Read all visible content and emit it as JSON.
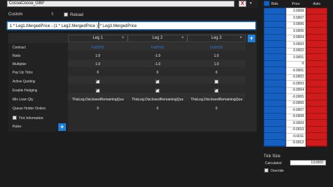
{
  "topbar": {
    "symbol": "CocoaCocoa_GBP",
    "close": "X"
  },
  "toolbar": {
    "mode": "Custom",
    "reload": "Reload"
  },
  "formula": {
    "left": "1 * Leg1.MergedPrice - (1 * Leg2.MergedPrice )",
    "right": "* Leg3.MergedPrice"
  },
  "grid": {
    "legs": [
      "Leg 1",
      "Leg 2",
      "Leg 3"
    ],
    "close_glyph": "×",
    "add": "+",
    "rows": [
      {
        "label": "Contract",
        "values": [
          "Fut2015",
          "Fut2015",
          "Fut2015"
        ]
      },
      {
        "label": "Ratio",
        "values": [
          "1.0",
          "-1.0",
          "1.0"
        ]
      },
      {
        "label": "Multiplier",
        "values": [
          "1.0",
          "-1.0",
          "1.0"
        ]
      },
      {
        "label": "Pay Up Ticks",
        "values": [
          "0",
          "0",
          "0"
        ]
      },
      {
        "label": "Active Quoting",
        "checks": [
          true,
          true,
          false
        ]
      },
      {
        "label": "Enable Hedging",
        "checks": [
          true,
          true,
          true
        ]
      },
      {
        "label": "Min Lean Qty",
        "values": [
          "ThisLeg.DisclosedRemainingQua",
          "ThisLeg.DisclosedRemainingQua",
          "ThisLeg.DisclosedRemainingQua"
        ]
      },
      {
        "label": "Queue Holder Orders",
        "values": [
          "0",
          "0",
          "0"
        ]
      }
    ],
    "tick_information": "Tick Information",
    "rules": "Rules"
  },
  "ladder": {
    "headers": [
      "Bids",
      "Price",
      "Asks"
    ],
    "prices": [
      "0.0008",
      "0.0007",
      "0.0006",
      "0.0005",
      "0.0004",
      "0.0003",
      "0.0002",
      "0.0001",
      "0",
      "-0.0001",
      "-0.0002",
      "-0.0003",
      "-0.0004",
      "-0.0005",
      "-0.0006",
      "-0.0007",
      "-0.0008",
      "-0.0009",
      "-0.0010",
      "-0.0011",
      "-0.0012"
    ],
    "colors": {
      "bid": "#1560c0",
      "ask": "#cf1b1b",
      "accent": "#1e7fd8"
    }
  },
  "ticksize": {
    "title": "Tick Size",
    "calculated_label": "Calculated",
    "calculated_value": "1/10000",
    "override": "Override"
  }
}
